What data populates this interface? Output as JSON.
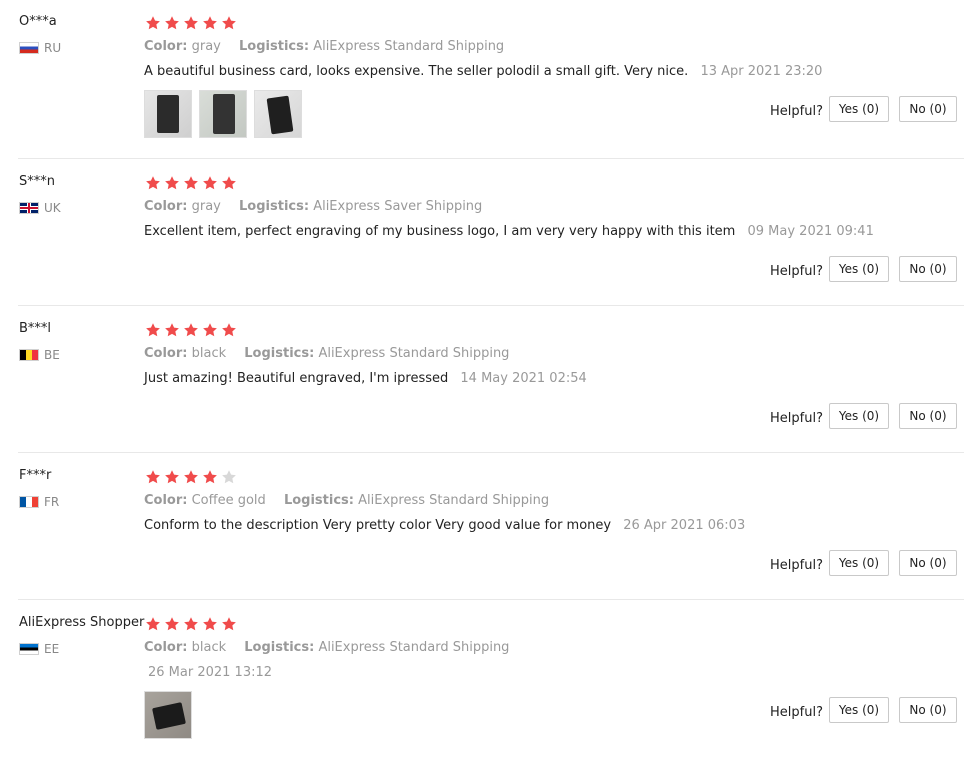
{
  "helpful_label": "Helpful?",
  "color_key": "Color:",
  "logistics_key": "Logistics:",
  "star_color": "#f04b4b",
  "star_empty_color": "#d8d8d8",
  "reviews": [
    {
      "name": "O***a",
      "country": "RU",
      "rating": 5,
      "color": "gray",
      "logistics": "AliExpress Standard Shipping",
      "text": "A beautiful business card, looks expensive. The seller polodil a small gift. Very nice.",
      "date": "13 Apr 2021 23:20",
      "photos": 3,
      "yes": "Yes (0)",
      "no": "No (0)"
    },
    {
      "name": "S***n",
      "country": "UK",
      "rating": 5,
      "color": "gray",
      "logistics": "AliExpress Saver Shipping",
      "text": "Excellent item, perfect engraving of my business logo, I am very very happy with this item",
      "date": "09 May 2021 09:41",
      "photos": 0,
      "yes": "Yes (0)",
      "no": "No (0)"
    },
    {
      "name": "B***l",
      "country": "BE",
      "rating": 5,
      "color": "black",
      "logistics": "AliExpress Standard Shipping",
      "text": "Just amazing! Beautiful engraved, I'm ipressed",
      "date": "14 May 2021 02:54",
      "photos": 0,
      "yes": "Yes (0)",
      "no": "No (0)"
    },
    {
      "name": "F***r",
      "country": "FR",
      "rating": 4,
      "color": "Coffee gold",
      "logistics": "AliExpress Standard Shipping",
      "text": "Conform to the description Very pretty color Very good value for money",
      "date": "26 Apr 2021 06:03",
      "photos": 0,
      "yes": "Yes (0)",
      "no": "No (0)"
    },
    {
      "name": "AliExpress Shopper",
      "country": "EE",
      "rating": 5,
      "color": "black",
      "logistics": "AliExpress Standard Shipping",
      "text": "",
      "date": "26 Mar 2021 13:12",
      "photos": 1,
      "yes": "Yes (0)",
      "no": "No (0)"
    }
  ]
}
